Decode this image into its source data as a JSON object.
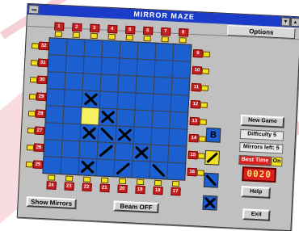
{
  "window": {
    "title": "MIRROR MAZE"
  },
  "menu": {
    "options_label": "Options"
  },
  "ports": {
    "top": [
      "1",
      "2",
      "3",
      "4",
      "5",
      "6",
      "7",
      "8"
    ],
    "right": [
      "9",
      "10",
      "11",
      "12",
      "13",
      "14",
      "15",
      "16"
    ],
    "bottom": [
      "24",
      "23",
      "22",
      "21",
      "20",
      "19",
      "18",
      "17"
    ],
    "left": [
      "32",
      "31",
      "30",
      "29",
      "28",
      "27",
      "26",
      "25"
    ]
  },
  "board": {
    "rows": 8,
    "cols": 8,
    "cells": [
      {
        "r": 3,
        "c": 2,
        "mark": "x"
      },
      {
        "r": 4,
        "c": 2,
        "mark": "lit"
      },
      {
        "r": 4,
        "c": 3,
        "mark": "x"
      },
      {
        "r": 5,
        "c": 2,
        "mark": "x"
      },
      {
        "r": 5,
        "c": 3,
        "mark": "backslash"
      },
      {
        "r": 5,
        "c": 4,
        "mark": "x"
      },
      {
        "r": 6,
        "c": 3,
        "mark": "slash"
      },
      {
        "r": 6,
        "c": 5,
        "mark": "x"
      },
      {
        "r": 7,
        "c": 2,
        "mark": "x"
      },
      {
        "r": 7,
        "c": 4,
        "mark": "slash"
      },
      {
        "r": 7,
        "c": 6,
        "mark": "backslash"
      }
    ]
  },
  "side_panel": {
    "new_game": "New Game",
    "difficulty": "Difficulty 5",
    "mirrors_left": "Mirrors left: 5",
    "best_time_label": "Best Time",
    "best_time_toggle": "On",
    "timer": "0020",
    "help": "Help",
    "exit": "Exit"
  },
  "tools": [
    {
      "icon": "b-icon",
      "label": "B"
    },
    {
      "icon": "slash-mirror-icon"
    },
    {
      "icon": "backslash-mirror-icon"
    },
    {
      "icon": "x-blocker-icon"
    }
  ],
  "buttons": {
    "show_mirrors": "Show Mirrors",
    "beam": "Beam OFF"
  },
  "colors": {
    "board_blue": "#1c5fd0",
    "highlight_yellow": "#f4f060",
    "title_blue": "#1a3cc8",
    "port_red": "#c02020",
    "timer_red": "#d82020"
  }
}
